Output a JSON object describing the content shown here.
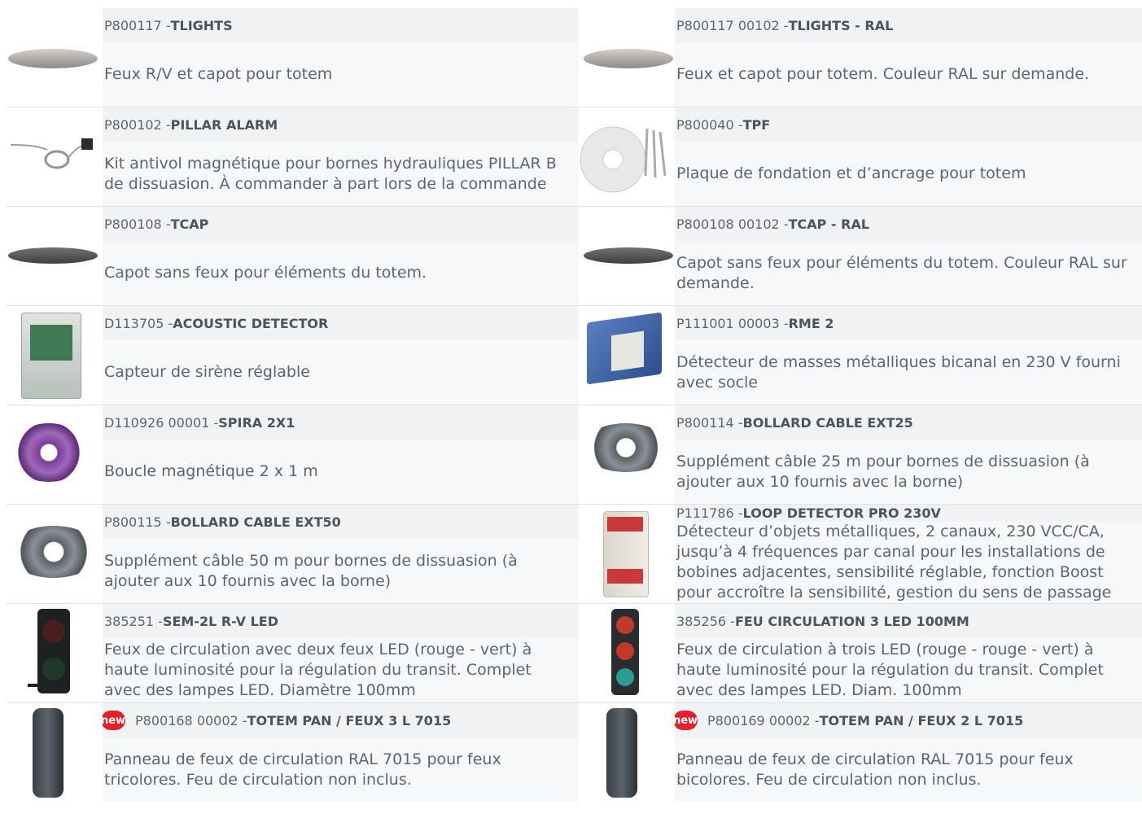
{
  "rows": [
    [
      {
        "code": "P800117 - ",
        "name": "TLIGHTS",
        "desc": "Feux R/V et capot pour totem",
        "icon": "traffic-light-cap-image"
      },
      {
        "code": "P800117 00102 - ",
        "name": "TLIGHTS - RAL",
        "desc": "Feux et capot pour totem. Couleur RAL sur demande.",
        "icon": "traffic-light-cap-image"
      }
    ],
    [
      {
        "code": "P800102 - ",
        "name": "PILLAR ALARM",
        "desc": "Kit antivol magnétique pour bornes hydrauliques PILLAR B de dissuasion. À commander à part lors de la commande",
        "icon": "alarm-kit-image"
      },
      {
        "code": "P800040 - ",
        "name": "TPF",
        "desc": "Plaque de fondation et d’ancrage pour totem",
        "icon": "foundation-plate-image"
      }
    ],
    [
      {
        "code": "P800108 - ",
        "name": "TCAP",
        "desc": "Capot sans feux pour éléments du totem.",
        "icon": "cap-image"
      },
      {
        "code": "P800108 00102 - ",
        "name": "TCAP - RAL",
        "desc": "Capot sans feux pour éléments du totem. Couleur RAL sur demande.",
        "icon": "cap-image"
      }
    ],
    [
      {
        "code": "D113705 - ",
        "name": "ACOUSTIC DETECTOR",
        "desc": "Capteur de sirène réglable",
        "icon": "detector-board-image"
      },
      {
        "code": "P111001 00003 - ",
        "name": "RME 2",
        "desc": "Détecteur de masses métalliques bicanal en 230 V fourni avec socle",
        "icon": "metal-detector-image"
      }
    ],
    [
      {
        "code": "D110926 00001 - ",
        "name": "SPIRA 2X1",
        "desc": "Boucle magnétique 2 x 1 m",
        "icon": "purple-cable-coil-image"
      },
      {
        "code": "P800114 - ",
        "name": "BOLLARD CABLE EXT25",
        "desc": "Supplément câble 25 m pour bornes de dissuasion (à ajouter aux 10 fournis avec la borne)",
        "icon": "grey-cable-coil-image"
      }
    ],
    [
      {
        "code": "P800115 - ",
        "name": "BOLLARD CABLE EXT50",
        "desc": "Supplément câble 50 m pour bornes de dissuasion (à ajouter aux 10 fournis avec la borne)",
        "icon": "grey-cable-coil-image"
      },
      {
        "code": "P111786 - ",
        "name": "LOOP DETECTOR PRO 230V",
        "desc": "Détecteur d’objets métalliques, 2 canaux, 230 VCC/CA, jusqu’à 4 fréquences par canal pour les installations de bobines adjacentes, sensibilité réglable, fonction Boost pour accroître la sensibilité, gestion du sens de passage",
        "icon": "din-rail-detector-image"
      }
    ],
    [
      {
        "code": "385251 - ",
        "name": "SEM-2L R-V LED",
        "desc": "Feux de circulation avec deux feux LED (rouge - vert) à haute luminosité pour la régulation du transit. Complet avec des lampes LED. Diamètre 100mm",
        "icon": "two-light-signal-image"
      },
      {
        "code": "385256 - ",
        "name": "FEU CIRCULATION 3 LED 100MM",
        "desc": "Feux de circulation à trois LED (rouge - rouge - vert) à haute luminosité pour la régulation du transit. Complet avec des lampes LED. Diam. 100mm",
        "icon": "three-light-signal-image"
      }
    ],
    [
      {
        "badge": "new",
        "code": "P800168 00002 - ",
        "name": "TOTEM PAN / FEUX 3 L 7015",
        "desc": "Panneau de feux de circulation RAL 7015 pour feux tricolores. Feu de circulation non inclus.",
        "icon": "totem-panel-image"
      },
      {
        "badge": "new",
        "code": "P800169 00002 - ",
        "name": "TOTEM PAN / FEUX 2 L 7015",
        "desc": "Panneau de feux de circulation RAL 7015 pour feux bicolores. Feu de circulation non inclus.",
        "icon": "totem-panel-image"
      }
    ]
  ]
}
